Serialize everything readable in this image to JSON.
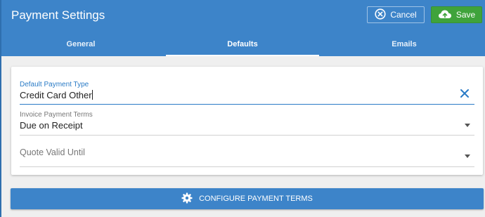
{
  "header": {
    "title": "Payment Settings",
    "cancel_label": "Cancel",
    "save_label": "Save"
  },
  "tabs": [
    {
      "label": "General",
      "active": false
    },
    {
      "label": "Defaults",
      "active": true
    },
    {
      "label": "Emails",
      "active": false
    }
  ],
  "form": {
    "default_payment_type": {
      "label": "Default Payment Type",
      "value": "Credit Card Other"
    },
    "invoice_payment_terms": {
      "label": "Invoice Payment Terms",
      "value": "Due on Receipt"
    },
    "quote_valid_until": {
      "placeholder": "Quote Valid Until",
      "value": ""
    }
  },
  "configure_button": {
    "label": "CONFIGURE PAYMENT TERMS"
  },
  "colors": {
    "header_blue": "#3d84c9",
    "save_green": "#3fa33b",
    "focus_blue": "#2a7bc6"
  },
  "icons": {
    "cancel": "x-circle-icon",
    "save": "cloud-upload-icon",
    "clear": "close-icon",
    "configure": "gear-icon"
  }
}
